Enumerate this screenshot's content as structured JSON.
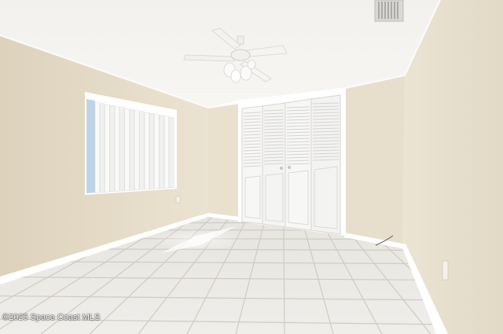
{
  "photo": {
    "watermark": "©2025 Space Coast MLS"
  },
  "palette": {
    "ceiling": "#f4f2ee",
    "wall_left": "#e8dfcb",
    "wall_back": "#eae2cf",
    "wall_right": "#ede6d6",
    "floor": "#e9e7e3",
    "grout": "#c9c5bd",
    "trim": "#ffffff",
    "door": "#f6f6f6",
    "window_sky": "#bfd3e6"
  },
  "icons": {
    "fan": "ceiling-fan-icon",
    "vent": "air-vent-icon",
    "outlet": "wall-outlet-icon"
  }
}
